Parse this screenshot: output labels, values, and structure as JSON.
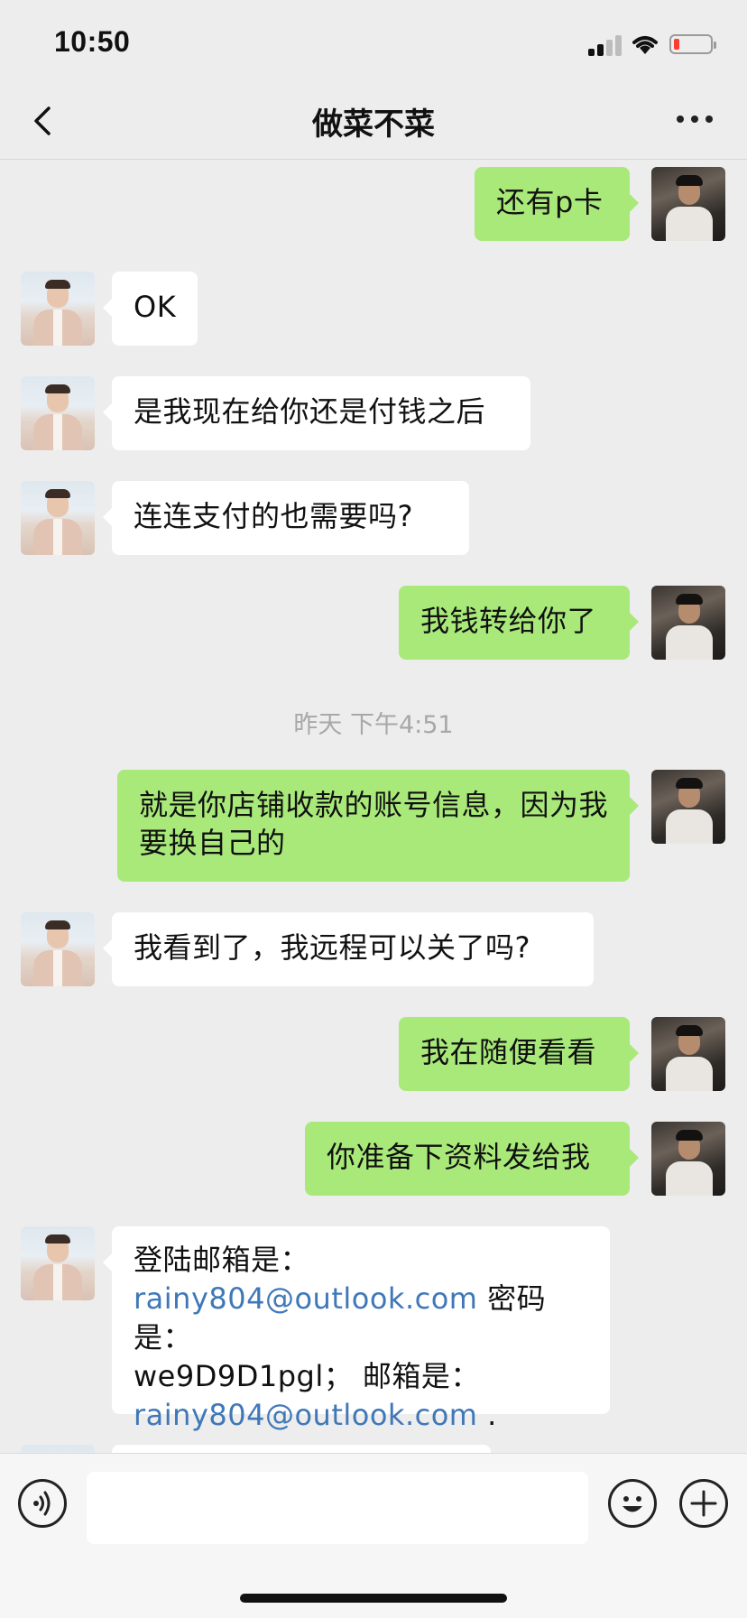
{
  "status_bar": {
    "time": "10:50"
  },
  "nav": {
    "title": "做菜不菜"
  },
  "messages": [
    {
      "side": "right",
      "text": "还有p卡"
    },
    {
      "side": "left",
      "text": "OK"
    },
    {
      "side": "left",
      "text": "是我现在给你还是付钱之后"
    },
    {
      "side": "left",
      "text": "连连支付的也需要吗?"
    },
    {
      "side": "right",
      "text": "我钱转给你了"
    },
    {
      "timestamp": "昨天 下午4:51"
    },
    {
      "side": "right",
      "text": "就是你店铺收款的账号信息，因为我要换自己的"
    },
    {
      "side": "left",
      "text": "我看到了，我远程可以关了吗?"
    },
    {
      "side": "right",
      "text": "我在随便看看"
    },
    {
      "side": "right",
      "text": "你准备下资料发给我"
    },
    {
      "side": "left",
      "parts": {
        "p1": "登陆邮箱是：",
        "link1": "rainy804@outlook.com",
        "p2": " 密码是：",
        "p3": "we9D9D1pgl；  邮箱是：",
        "link2": "rainy804@outlook.com",
        "p4": " ."
      }
    }
  ],
  "icons": [
    "back-chevron-icon",
    "more-dots-icon",
    "voice-icon",
    "emoji-icon",
    "plus-icon"
  ],
  "colors": {
    "sent_bubble": "#a9e97a",
    "received_bubble": "#ffffff",
    "link": "#3f78b8",
    "background": "#ededed"
  }
}
